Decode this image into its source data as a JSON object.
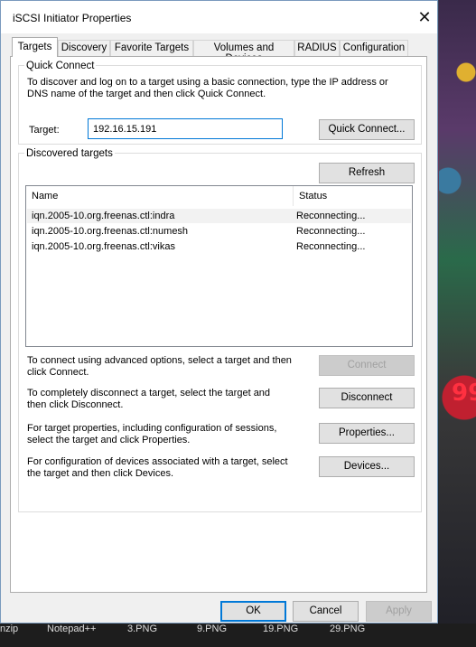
{
  "window": {
    "title": "iSCSI Initiator Properties",
    "close_glyph": "✕"
  },
  "tabs": [
    {
      "label": "Targets",
      "active": true
    },
    {
      "label": "Discovery"
    },
    {
      "label": "Favorite Targets"
    },
    {
      "label": "Volumes and Devices"
    },
    {
      "label": "RADIUS"
    },
    {
      "label": "Configuration"
    }
  ],
  "quick_connect": {
    "group_title": "Quick Connect",
    "description": "To discover and log on to a target using a basic connection, type the IP address or DNS name of the target and then click Quick Connect.",
    "target_label": "Target:",
    "target_value": "192.16.15.191",
    "button": "Quick Connect..."
  },
  "discovered": {
    "group_title": "Discovered targets",
    "refresh_button": "Refresh",
    "columns": [
      "Name",
      "Status"
    ],
    "rows": [
      {
        "name": "iqn.2005-10.org.freenas.ctl:indra",
        "status": "Reconnecting..."
      },
      {
        "name": "iqn.2005-10.org.freenas.ctl:numesh",
        "status": "Reconnecting..."
      },
      {
        "name": "iqn.2005-10.org.freenas.ctl:vikas",
        "status": "Reconnecting..."
      }
    ],
    "actions": [
      {
        "text": "To connect using advanced options, select a target and then click Connect.",
        "button": "Connect",
        "enabled": false
      },
      {
        "text": "To completely disconnect a target, select the target and then click Disconnect.",
        "button": "Disconnect",
        "enabled": true
      },
      {
        "text": "For target properties, including configuration of sessions, select the target and click Properties.",
        "button": "Properties...",
        "enabled": true
      },
      {
        "text": "For configuration of devices associated with a target, select the target and then click Devices.",
        "button": "Devices...",
        "enabled": true
      }
    ]
  },
  "footer": {
    "ok": "OK",
    "cancel": "Cancel",
    "apply": "Apply"
  },
  "taskbar": [
    "nzip",
    "Notepad++",
    "3.PNG",
    "9.PNG",
    "19.PNG",
    "29.PNG"
  ],
  "desktop_fragments": {
    "right_text": "99"
  },
  "colors": {
    "accent": "#0078d7",
    "window_bg": "#f0f0f0",
    "panel_bg": "#ffffff"
  }
}
